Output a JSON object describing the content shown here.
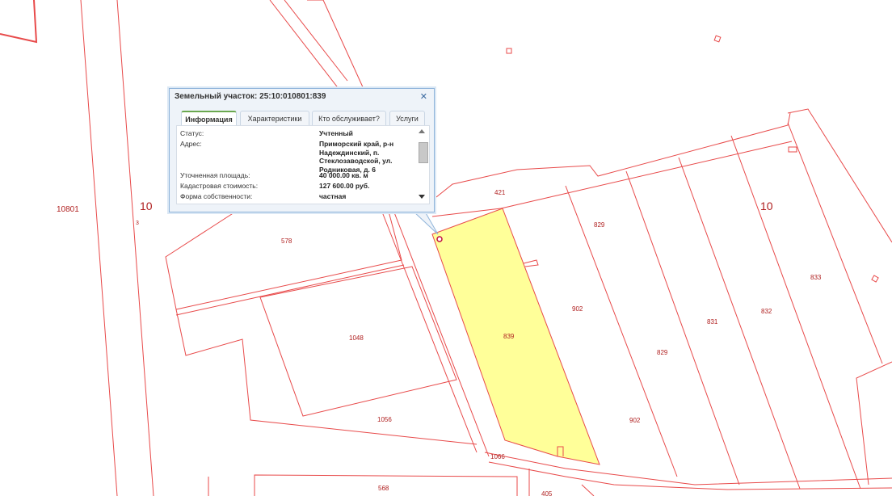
{
  "map": {
    "colors": {
      "boundary": "#e84a4a",
      "selected_fill": "#ffff99",
      "label": "#b02020"
    },
    "labels": {
      "block_left": "10801",
      "block_num_left": "10",
      "small_3": "3",
      "block_num_right": "10",
      "p578": "578",
      "p421": "421",
      "p829a": "829",
      "p833": "833",
      "p902a": "902",
      "p831": "831",
      "p832": "832",
      "p829b": "829",
      "p1048": "1048",
      "p839": "839",
      "p1056": "1056",
      "p902b": "902",
      "p1066": "1066",
      "p568": "568",
      "p405": "405"
    }
  },
  "popup": {
    "title": "Земельный участок: 25:10:010801:839",
    "close_icon": "close-icon",
    "tabs": [
      "Информация",
      "Характеристики",
      "Кто обслуживает?",
      "Услуги"
    ],
    "active_tab": 0,
    "fields": {
      "status_label": "Статус:",
      "status_value": "Учтенный",
      "address_label": "Адрес:",
      "address_lines": [
        "Приморский край, р-н",
        "Надеждинский, п.",
        "Стеклозаводской, ул.",
        "Родниковая, д. 6"
      ],
      "area_label": "Уточненная площадь:",
      "area_value": "40 000.00 кв. м",
      "cost_label": "Кадастровая стоимость:",
      "cost_value": "127 600.00 руб.",
      "ownership_label": "Форма собственности:",
      "ownership_value": "частная"
    }
  }
}
